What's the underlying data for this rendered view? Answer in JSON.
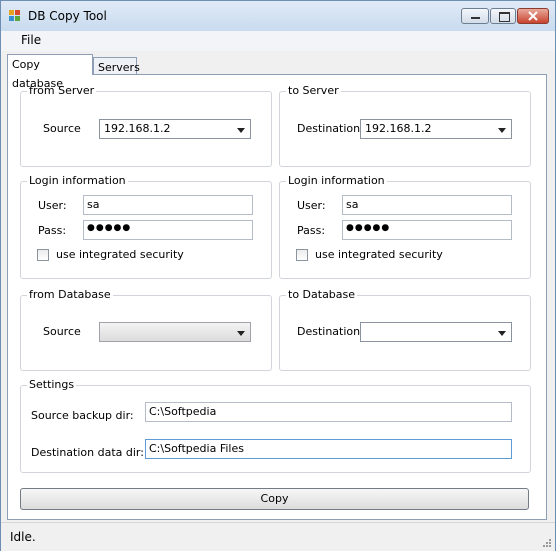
{
  "window": {
    "title": "DB Copy Tool"
  },
  "menu": {
    "file": "File"
  },
  "tabs": {
    "copy_database": "Copy database",
    "servers": "Servers"
  },
  "from_server": {
    "title": "from Server",
    "source_label": "Source",
    "source_value": "192.168.1.2"
  },
  "to_server": {
    "title": "to Server",
    "destination_label": "Destination",
    "destination_value": "192.168.1.2"
  },
  "login_left": {
    "title": "Login information",
    "user_label": "User:",
    "user_value": "sa",
    "pass_label": "Pass:",
    "pass_value": "●●●●●",
    "integrated_label": "use integrated security"
  },
  "login_right": {
    "title": "Login information",
    "user_label": "User:",
    "user_value": "sa",
    "pass_label": "Pass:",
    "pass_value": "●●●●●",
    "integrated_label": "use integrated security"
  },
  "from_database": {
    "title": "from Database",
    "source_label": "Source",
    "source_value": ""
  },
  "to_database": {
    "title": "to Database",
    "destination_label": "Destination",
    "destination_value": ""
  },
  "settings": {
    "title": "Settings",
    "backup_label": "Source backup dir:",
    "backup_value": "C:\\Softpedia",
    "data_label": "Destination data dir:",
    "data_value": "C:\\Softpedia Files"
  },
  "actions": {
    "copy_label": "Copy"
  },
  "status": {
    "text": "Idle."
  }
}
